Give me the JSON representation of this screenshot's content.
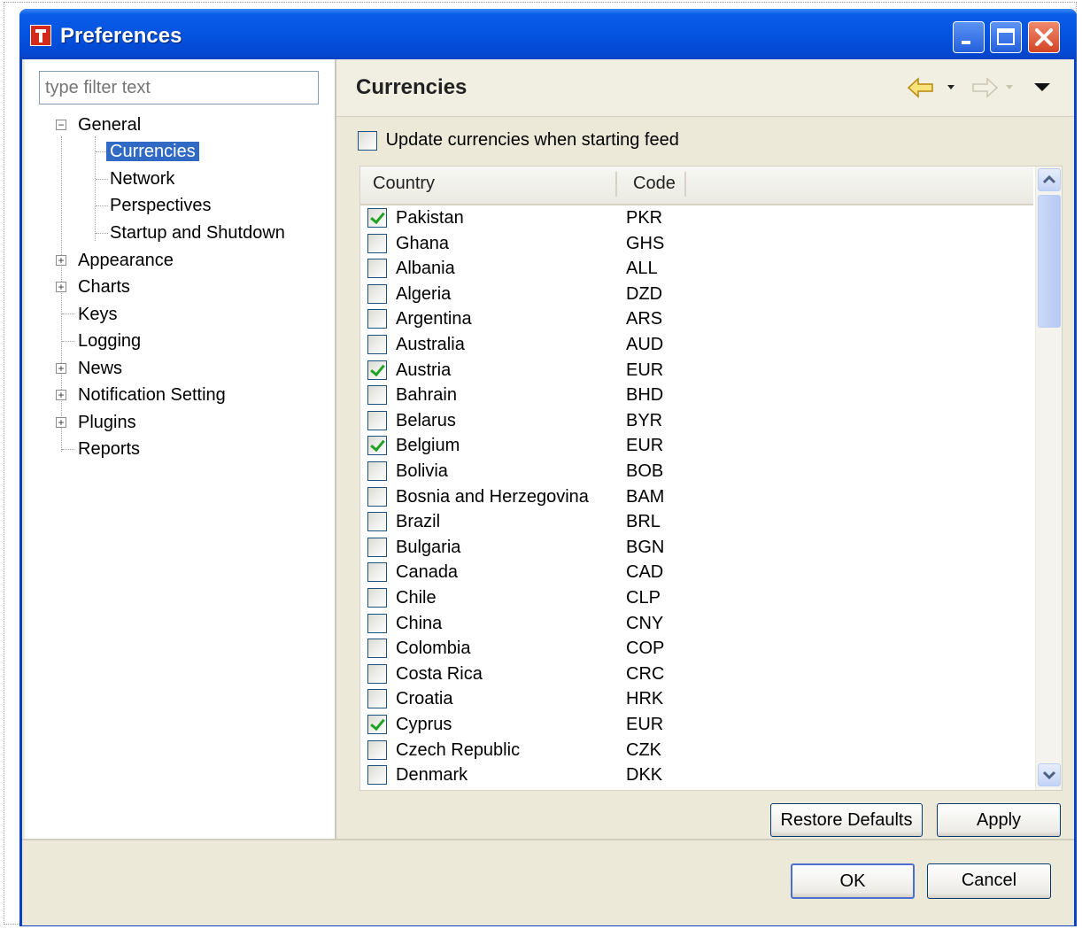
{
  "window": {
    "title": "Preferences"
  },
  "filter": {
    "placeholder": "type filter text"
  },
  "tree": {
    "general": "General",
    "currencies": "Currencies",
    "network": "Network",
    "perspectives": "Perspectives",
    "startup": "Startup and Shutdown",
    "appearance": "Appearance",
    "charts": "Charts",
    "keys": "Keys",
    "logging": "Logging",
    "news": "News",
    "notification": "Notification Setting",
    "plugins": "Plugins",
    "reports": "Reports"
  },
  "page": {
    "title": "Currencies",
    "update_label": "Update currencies when starting feed",
    "update_checked": false
  },
  "table": {
    "columns": [
      "Country",
      "Code"
    ],
    "rows": [
      {
        "country": "Pakistan",
        "code": "PKR",
        "checked": true
      },
      {
        "country": "Ghana",
        "code": "GHS",
        "checked": false
      },
      {
        "country": "Albania",
        "code": "ALL",
        "checked": false
      },
      {
        "country": "Algeria",
        "code": "DZD",
        "checked": false
      },
      {
        "country": "Argentina",
        "code": "ARS",
        "checked": false
      },
      {
        "country": "Australia",
        "code": "AUD",
        "checked": false
      },
      {
        "country": "Austria",
        "code": "EUR",
        "checked": true
      },
      {
        "country": "Bahrain",
        "code": "BHD",
        "checked": false
      },
      {
        "country": "Belarus",
        "code": "BYR",
        "checked": false
      },
      {
        "country": "Belgium",
        "code": "EUR",
        "checked": true
      },
      {
        "country": "Bolivia",
        "code": "BOB",
        "checked": false
      },
      {
        "country": "Bosnia and Herzegovina",
        "code": "BAM",
        "checked": false
      },
      {
        "country": "Brazil",
        "code": "BRL",
        "checked": false
      },
      {
        "country": "Bulgaria",
        "code": "BGN",
        "checked": false
      },
      {
        "country": "Canada",
        "code": "CAD",
        "checked": false
      },
      {
        "country": "Chile",
        "code": "CLP",
        "checked": false
      },
      {
        "country": "China",
        "code": "CNY",
        "checked": false
      },
      {
        "country": "Colombia",
        "code": "COP",
        "checked": false
      },
      {
        "country": "Costa Rica",
        "code": "CRC",
        "checked": false
      },
      {
        "country": "Croatia",
        "code": "HRK",
        "checked": false
      },
      {
        "country": "Cyprus",
        "code": "EUR",
        "checked": true
      },
      {
        "country": "Czech Republic",
        "code": "CZK",
        "checked": false
      },
      {
        "country": "Denmark",
        "code": "DKK",
        "checked": false
      }
    ]
  },
  "buttons": {
    "restore": "Restore Defaults",
    "apply": "Apply",
    "ok": "OK",
    "cancel": "Cancel"
  },
  "colors": {
    "titlebar": "#0453e0",
    "selection": "#316ac5",
    "check": "#21a121"
  },
  "icons": [
    "app-icon",
    "minimize-icon",
    "maximize-icon",
    "close-icon",
    "back-arrow-icon",
    "forward-arrow-icon",
    "view-menu-icon",
    "chevron-up-icon",
    "chevron-down-icon"
  ]
}
